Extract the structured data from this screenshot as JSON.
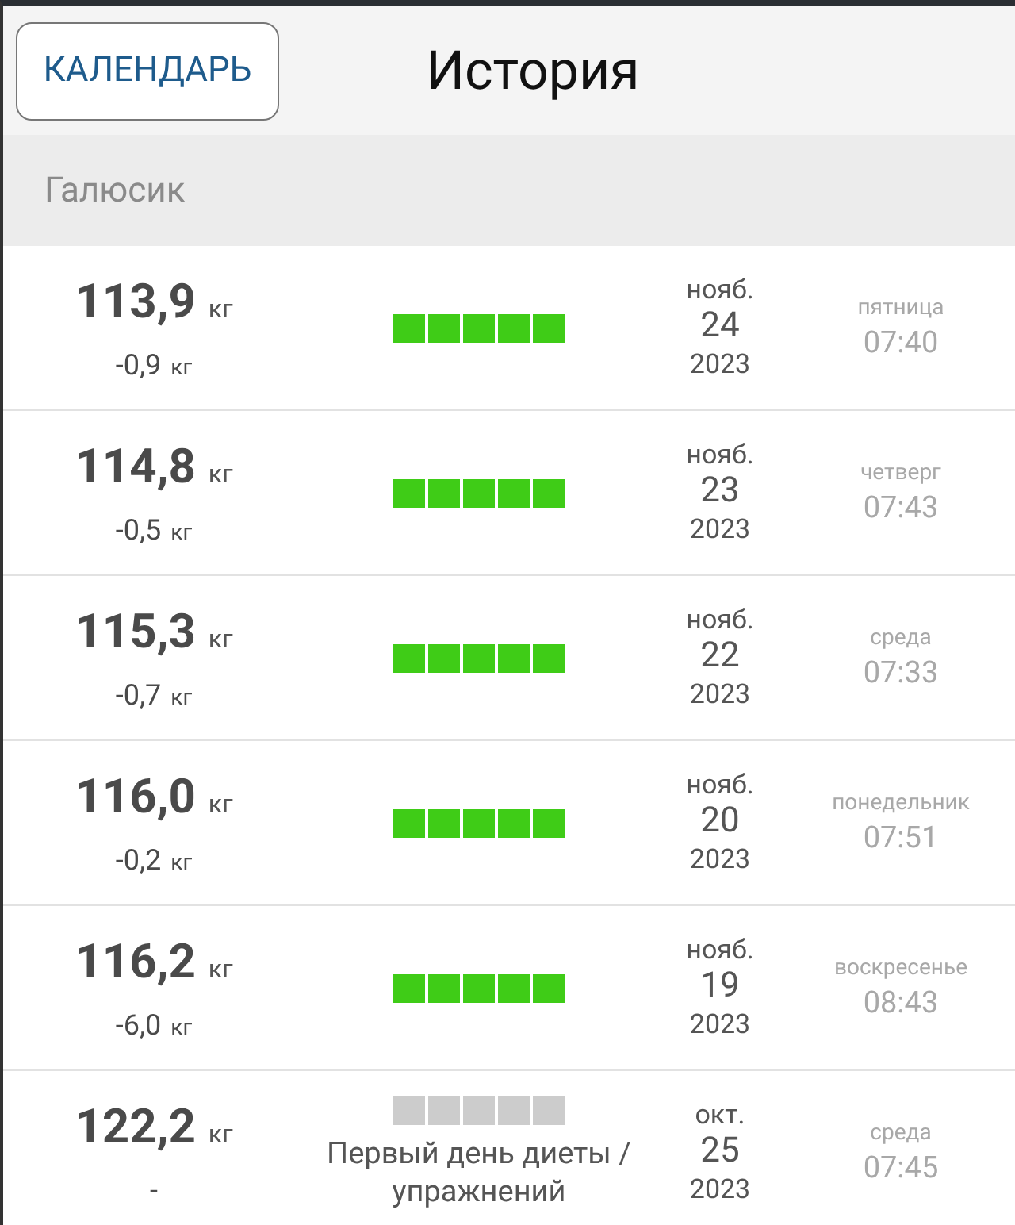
{
  "header": {
    "button": "КАЛЕНДАРЬ",
    "title": "История"
  },
  "section": "Галюсик",
  "entries": [
    {
      "weight": "113,9",
      "unit": "кг",
      "change": "-0,9",
      "change_unit": "кг",
      "stars": 5,
      "month": "нояб.",
      "day": "24",
      "year": "2023",
      "weekday": "пятница",
      "time": "07:40"
    },
    {
      "weight": "114,8",
      "unit": "кг",
      "change": "-0,5",
      "change_unit": "кг",
      "stars": 5,
      "month": "нояб.",
      "day": "23",
      "year": "2023",
      "weekday": "четверг",
      "time": "07:43"
    },
    {
      "weight": "115,3",
      "unit": "кг",
      "change": "-0,7",
      "change_unit": "кг",
      "stars": 5,
      "month": "нояб.",
      "day": "22",
      "year": "2023",
      "weekday": "среда",
      "time": "07:33"
    },
    {
      "weight": "116,0",
      "unit": "кг",
      "change": "-0,2",
      "change_unit": "кг",
      "stars": 5,
      "month": "нояб.",
      "day": "20",
      "year": "2023",
      "weekday": "понедельник",
      "time": "07:51"
    },
    {
      "weight": "116,2",
      "unit": "кг",
      "change": "-6,0",
      "change_unit": "кг",
      "stars": 5,
      "month": "нояб.",
      "day": "19",
      "year": "2023",
      "weekday": "воскресенье",
      "time": "08:43"
    },
    {
      "weight": "122,2",
      "unit": "кг",
      "change": "-",
      "stars": 0,
      "note": "Первый день диеты / упражнений",
      "month": "окт.",
      "day": "25",
      "year": "2023",
      "weekday": "среда",
      "time": "07:45"
    }
  ]
}
